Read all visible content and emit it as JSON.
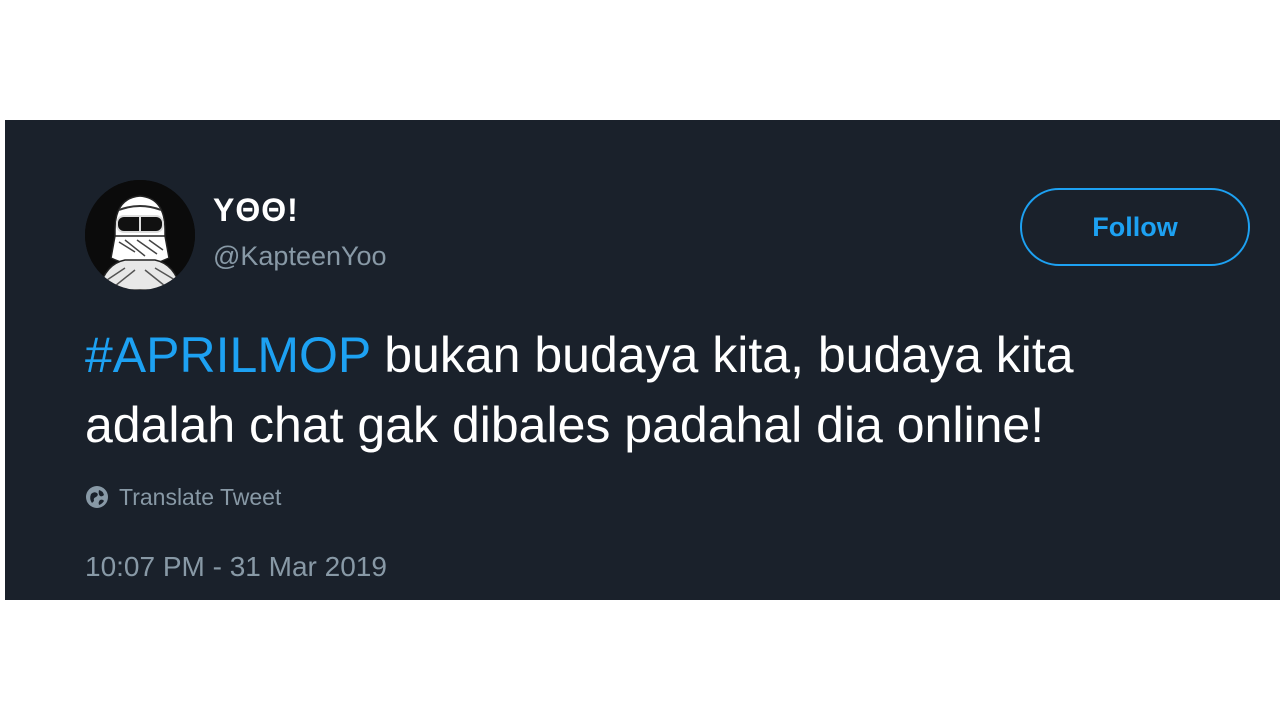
{
  "user": {
    "display_name": "YΘΘ!",
    "handle": "@KapteenYoo",
    "avatar_icon": "masked-rider-avatar"
  },
  "follow": {
    "label": "Follow"
  },
  "tweet": {
    "hashtag": "#APRILMOP",
    "line1_rest": " bukan budaya kita, budaya kita",
    "line2": "adalah chat gak dibales padahal dia online!"
  },
  "translate": {
    "label": "Translate Tweet",
    "icon": "globe-icon"
  },
  "timestamp": "10:07 PM - 31 Mar 2019",
  "colors": {
    "background": "#1a212b",
    "accent": "#1da1f2",
    "muted": "#8899a6",
    "text": "#ffffff"
  }
}
